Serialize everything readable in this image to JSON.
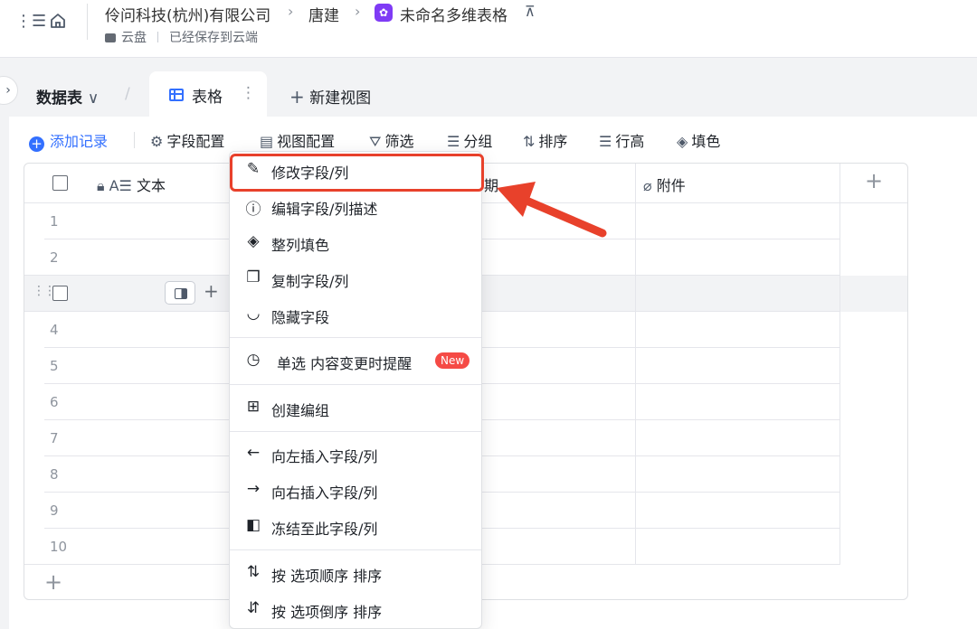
{
  "header": {
    "breadcrumbs": [
      "伶问科技(杭州)有限公司",
      "唐建",
      "未命名多维表格"
    ],
    "location": "云盘",
    "save_status": "已经保存到云端"
  },
  "tabs": {
    "datatable_label": "数据表",
    "active_view_label": "表格",
    "new_view_label": "新建视图"
  },
  "toolbar": {
    "add_record": "添加记录",
    "field_config": "字段配置",
    "view_config": "视图配置",
    "filter": "筛选",
    "group": "分组",
    "sort": "排序",
    "row_height": "行高",
    "fill": "填色"
  },
  "table": {
    "columns": [
      "文本",
      "期",
      "附件"
    ],
    "row_numbers": [
      "1",
      "2",
      "4",
      "5",
      "6",
      "7",
      "8",
      "9",
      "10"
    ]
  },
  "context_menu": {
    "items": [
      {
        "icon": "edit-icon",
        "label": "修改字段/列"
      },
      {
        "icon": "info-icon",
        "label": "编辑字段/列描述"
      },
      {
        "icon": "paint-bucket-icon",
        "label": "整列填色"
      },
      {
        "icon": "copy-icon",
        "label": "复制字段/列"
      },
      {
        "icon": "hide-eye-icon",
        "label": "隐藏字段"
      },
      {
        "icon": "clock-alert-icon",
        "label": "单选 内容变更时提醒",
        "badge": "New"
      },
      {
        "icon": "group-icon",
        "label": "创建编组"
      },
      {
        "icon": "arrow-left-icon",
        "label": "向左插入字段/列"
      },
      {
        "icon": "arrow-right-icon",
        "label": "向右插入字段/列"
      },
      {
        "icon": "freeze-icon",
        "label": "冻结至此字段/列"
      },
      {
        "icon": "sort-asc-icon",
        "label": "按 选项顺序 排序"
      },
      {
        "icon": "sort-desc-icon",
        "label": "按 选项倒序 排序"
      }
    ]
  },
  "colors": {
    "accent": "#3370ff",
    "highlight": "#e8412b",
    "new_badge": "#f54a45",
    "doc_icon": "#7f3bf5"
  }
}
